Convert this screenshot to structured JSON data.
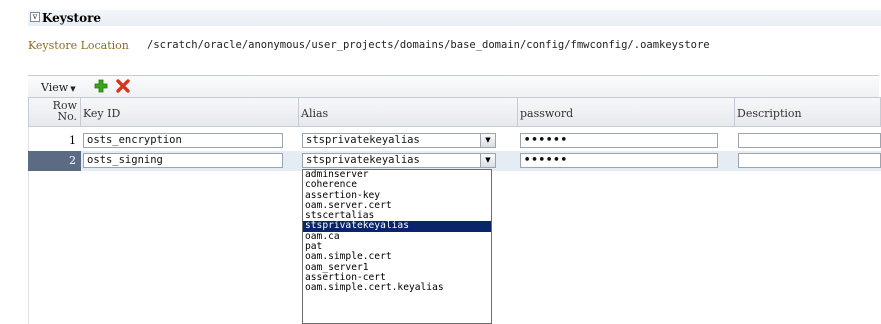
{
  "section": {
    "title": "Keystore",
    "collapse_glyph": "v"
  },
  "location": {
    "label": "Keystore Location",
    "path": "/scratch/oracle/anonymous/user_projects/domains/base_domain/config/fmwconfig/.oamkeystore"
  },
  "toolbar": {
    "view_label": "View",
    "view_chevron": "▼",
    "add_icon": "plus-icon",
    "delete_icon": "x-icon"
  },
  "table": {
    "columns": {
      "row_no": "Row No.",
      "row_no_line1": "Row",
      "row_no_line2": "No.",
      "key_id": "Key ID",
      "alias": "Alias",
      "password": "password",
      "description": "Description"
    },
    "rows": [
      {
        "num": "1",
        "key_id": "osts_encryption",
        "alias": "stsprivatekeyalias",
        "password": "••••••",
        "description": ""
      },
      {
        "num": "2",
        "key_id": "osts_signing",
        "alias": "stsprivatekeyalias",
        "password": "••••••",
        "description": "",
        "selected": true
      }
    ]
  },
  "alias_dropdown": {
    "options": [
      "adminserver",
      "coherence",
      "assertion-key",
      "oam.server.cert",
      "stscertalias",
      "stsprivatekeyalias",
      "oam.ca",
      "pat",
      "oam.simple.cert",
      "oam_server1",
      "assertion-cert",
      "oam.simple.cert.keyalias"
    ],
    "selected": "stsprivatekeyalias"
  },
  "colors": {
    "selected_row_number_bg": "#5b6b84",
    "selected_option_bg": "#0a246a",
    "location_label": "#8a6d1c",
    "add_icon": "#3aa516",
    "delete_icon": "#d8361c"
  }
}
